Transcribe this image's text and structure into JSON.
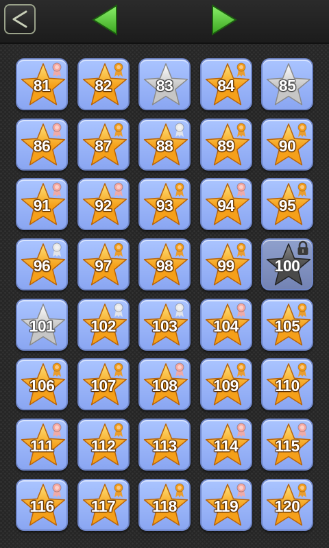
{
  "header": {
    "back_icon": "back-chevron-icon",
    "prev_icon": "triangle-left-icon",
    "next_icon": "triangle-right-icon",
    "arrow_color": "#5fd23a"
  },
  "colors": {
    "tile": "#9db8fb",
    "gold_star": "#f6a623",
    "silver_star": "#c9c9c9",
    "locked_star": "#555555",
    "medal_gold": "#f29a18",
    "medal_pink": "#f7a7a0",
    "medal_silver": "#e6e6e6"
  },
  "levels": [
    {
      "number": "81",
      "star": "gold",
      "medal": "pink"
    },
    {
      "number": "82",
      "star": "gold",
      "medal": "gold"
    },
    {
      "number": "83",
      "star": "silver",
      "medal": ""
    },
    {
      "number": "84",
      "star": "gold",
      "medal": "gold"
    },
    {
      "number": "85",
      "star": "silver",
      "medal": ""
    },
    {
      "number": "86",
      "star": "gold",
      "medal": "pink"
    },
    {
      "number": "87",
      "star": "gold",
      "medal": "gold"
    },
    {
      "number": "88",
      "star": "gold",
      "medal": "silver"
    },
    {
      "number": "89",
      "star": "gold",
      "medal": "gold"
    },
    {
      "number": "90",
      "star": "gold",
      "medal": "gold"
    },
    {
      "number": "91",
      "star": "gold",
      "medal": "pink"
    },
    {
      "number": "92",
      "star": "gold",
      "medal": "pink"
    },
    {
      "number": "93",
      "star": "gold",
      "medal": "gold"
    },
    {
      "number": "94",
      "star": "gold",
      "medal": "pink"
    },
    {
      "number": "95",
      "star": "gold",
      "medal": "gold"
    },
    {
      "number": "96",
      "star": "gold",
      "medal": "silver"
    },
    {
      "number": "97",
      "star": "gold",
      "medal": "gold"
    },
    {
      "number": "98",
      "star": "gold",
      "medal": "gold"
    },
    {
      "number": "99",
      "star": "gold",
      "medal": "gold"
    },
    {
      "number": "100",
      "star": "locked",
      "medal": "lock"
    },
    {
      "number": "101",
      "star": "silver",
      "medal": ""
    },
    {
      "number": "102",
      "star": "gold",
      "medal": "silver"
    },
    {
      "number": "103",
      "star": "gold",
      "medal": "silver"
    },
    {
      "number": "104",
      "star": "gold",
      "medal": "pink"
    },
    {
      "number": "105",
      "star": "gold",
      "medal": "gold"
    },
    {
      "number": "106",
      "star": "gold",
      "medal": "gold"
    },
    {
      "number": "107",
      "star": "gold",
      "medal": "gold"
    },
    {
      "number": "108",
      "star": "gold",
      "medal": "pink"
    },
    {
      "number": "109",
      "star": "gold",
      "medal": "gold"
    },
    {
      "number": "110",
      "star": "gold",
      "medal": "gold"
    },
    {
      "number": "111",
      "star": "gold",
      "medal": "pink"
    },
    {
      "number": "112",
      "star": "gold",
      "medal": "gold"
    },
    {
      "number": "113",
      "star": "gold",
      "medal": ""
    },
    {
      "number": "114",
      "star": "gold",
      "medal": "pink"
    },
    {
      "number": "115",
      "star": "gold",
      "medal": "pink"
    },
    {
      "number": "116",
      "star": "gold",
      "medal": "pink"
    },
    {
      "number": "117",
      "star": "gold",
      "medal": "gold"
    },
    {
      "number": "118",
      "star": "gold",
      "medal": "gold"
    },
    {
      "number": "119",
      "star": "gold",
      "medal": "pink"
    },
    {
      "number": "120",
      "star": "gold",
      "medal": "gold"
    }
  ]
}
